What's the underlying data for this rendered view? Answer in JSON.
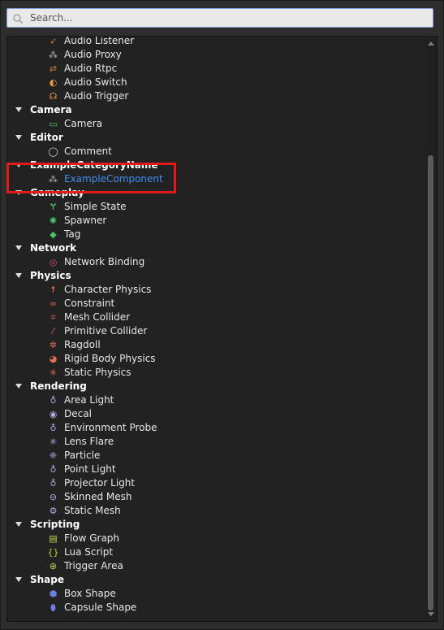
{
  "search": {
    "placeholder": "Search..."
  },
  "tree": [
    {
      "kind": "item",
      "label": "Audio Listener",
      "icon": "audio-listener-icon",
      "glyph": "➶",
      "color": "#c07a3a"
    },
    {
      "kind": "item",
      "label": "Audio Proxy",
      "icon": "audio-proxy-icon",
      "glyph": "⁂",
      "color": "#bdbdbd"
    },
    {
      "kind": "item",
      "label": "Audio Rtpc",
      "icon": "audio-rtpc-icon",
      "glyph": "⇄",
      "color": "#c07a3a"
    },
    {
      "kind": "item",
      "label": "Audio Switch",
      "icon": "audio-switch-icon",
      "glyph": "◐",
      "color": "#e09a4a"
    },
    {
      "kind": "item",
      "label": "Audio Trigger",
      "icon": "audio-trigger-icon",
      "glyph": "☊",
      "color": "#e09a4a"
    },
    {
      "kind": "category",
      "label": "Camera"
    },
    {
      "kind": "item",
      "label": "Camera",
      "icon": "camera-icon",
      "glyph": "▭",
      "color": "#4cc46a"
    },
    {
      "kind": "category",
      "label": "Editor"
    },
    {
      "kind": "item",
      "label": "Comment",
      "icon": "comment-icon",
      "glyph": "◯",
      "color": "#d0d0d0"
    },
    {
      "kind": "category",
      "label": "ExampleCategoryName"
    },
    {
      "kind": "item",
      "label": "ExampleComponent",
      "icon": "example-component-icon",
      "glyph": "⁂",
      "color": "#bdbdbd",
      "selected": true
    },
    {
      "kind": "category",
      "label": "Gameplay"
    },
    {
      "kind": "item",
      "label": "Simple State",
      "icon": "simple-state-icon",
      "glyph": "Ɏ",
      "color": "#4cc46a"
    },
    {
      "kind": "item",
      "label": "Spawner",
      "icon": "spawner-icon",
      "glyph": "✺",
      "color": "#4cc46a"
    },
    {
      "kind": "item",
      "label": "Tag",
      "icon": "tag-icon",
      "glyph": "◆",
      "color": "#4cc46a"
    },
    {
      "kind": "category",
      "label": "Network"
    },
    {
      "kind": "item",
      "label": "Network Binding",
      "icon": "network-binding-icon",
      "glyph": "◎",
      "color": "#d14a8e"
    },
    {
      "kind": "category",
      "label": "Physics"
    },
    {
      "kind": "item",
      "label": "Character Physics",
      "icon": "character-physics-icon",
      "glyph": "☨",
      "color": "#e07050"
    },
    {
      "kind": "item",
      "label": "Constraint",
      "icon": "constraint-icon",
      "glyph": "∞",
      "color": "#e07050"
    },
    {
      "kind": "item",
      "label": "Mesh Collider",
      "icon": "mesh-collider-icon",
      "glyph": "⌗",
      "color": "#e07050"
    },
    {
      "kind": "item",
      "label": "Primitive Collider",
      "icon": "primitive-collider-icon",
      "glyph": "⁄",
      "color": "#e07050"
    },
    {
      "kind": "item",
      "label": "Ragdoll",
      "icon": "ragdoll-icon",
      "glyph": "✲",
      "color": "#e07050"
    },
    {
      "kind": "item",
      "label": "Rigid Body Physics",
      "icon": "rigid-body-physics-icon",
      "glyph": "◕",
      "color": "#e07050"
    },
    {
      "kind": "item",
      "label": "Static Physics",
      "icon": "static-physics-icon",
      "glyph": "✳",
      "color": "#e07050"
    },
    {
      "kind": "category",
      "label": "Rendering"
    },
    {
      "kind": "item",
      "label": "Area Light",
      "icon": "area-light-icon",
      "glyph": "♁",
      "color": "#b9a7e8"
    },
    {
      "kind": "item",
      "label": "Decal",
      "icon": "decal-icon",
      "glyph": "◉",
      "color": "#b9a7e8"
    },
    {
      "kind": "item",
      "label": "Environment Probe",
      "icon": "environment-probe-icon",
      "glyph": "♁",
      "color": "#b9a7e8"
    },
    {
      "kind": "item",
      "label": "Lens Flare",
      "icon": "lens-flare-icon",
      "glyph": "✳",
      "color": "#b9a7e8"
    },
    {
      "kind": "item",
      "label": "Particle",
      "icon": "particle-icon",
      "glyph": "❈",
      "color": "#b9a7e8"
    },
    {
      "kind": "item",
      "label": "Point Light",
      "icon": "point-light-icon",
      "glyph": "♁",
      "color": "#b9a7e8"
    },
    {
      "kind": "item",
      "label": "Projector Light",
      "icon": "projector-light-icon",
      "glyph": "♁",
      "color": "#b9a7e8"
    },
    {
      "kind": "item",
      "label": "Skinned Mesh",
      "icon": "skinned-mesh-icon",
      "glyph": "⊖",
      "color": "#b9a7e8"
    },
    {
      "kind": "item",
      "label": "Static Mesh",
      "icon": "static-mesh-icon",
      "glyph": "⚙",
      "color": "#b9a7e8"
    },
    {
      "kind": "category",
      "label": "Scripting"
    },
    {
      "kind": "item",
      "label": "Flow Graph",
      "icon": "flow-graph-icon",
      "glyph": "▤",
      "color": "#b8d24a"
    },
    {
      "kind": "item",
      "label": "Lua Script",
      "icon": "lua-script-icon",
      "glyph": "{}",
      "color": "#b8d24a"
    },
    {
      "kind": "item",
      "label": "Trigger Area",
      "icon": "trigger-area-icon",
      "glyph": "⊕",
      "color": "#b8d24a"
    },
    {
      "kind": "category",
      "label": "Shape"
    },
    {
      "kind": "item",
      "label": "Box Shape",
      "icon": "box-shape-icon",
      "glyph": "⬢",
      "color": "#6a7fe0"
    },
    {
      "kind": "item",
      "label": "Capsule Shape",
      "icon": "capsule-shape-icon",
      "glyph": "⬮",
      "color": "#6a7fe0"
    }
  ],
  "colors": {
    "selected": "#3d8ef0",
    "highlight": "#e01b1b",
    "accent_border": "#7fa2d6"
  }
}
